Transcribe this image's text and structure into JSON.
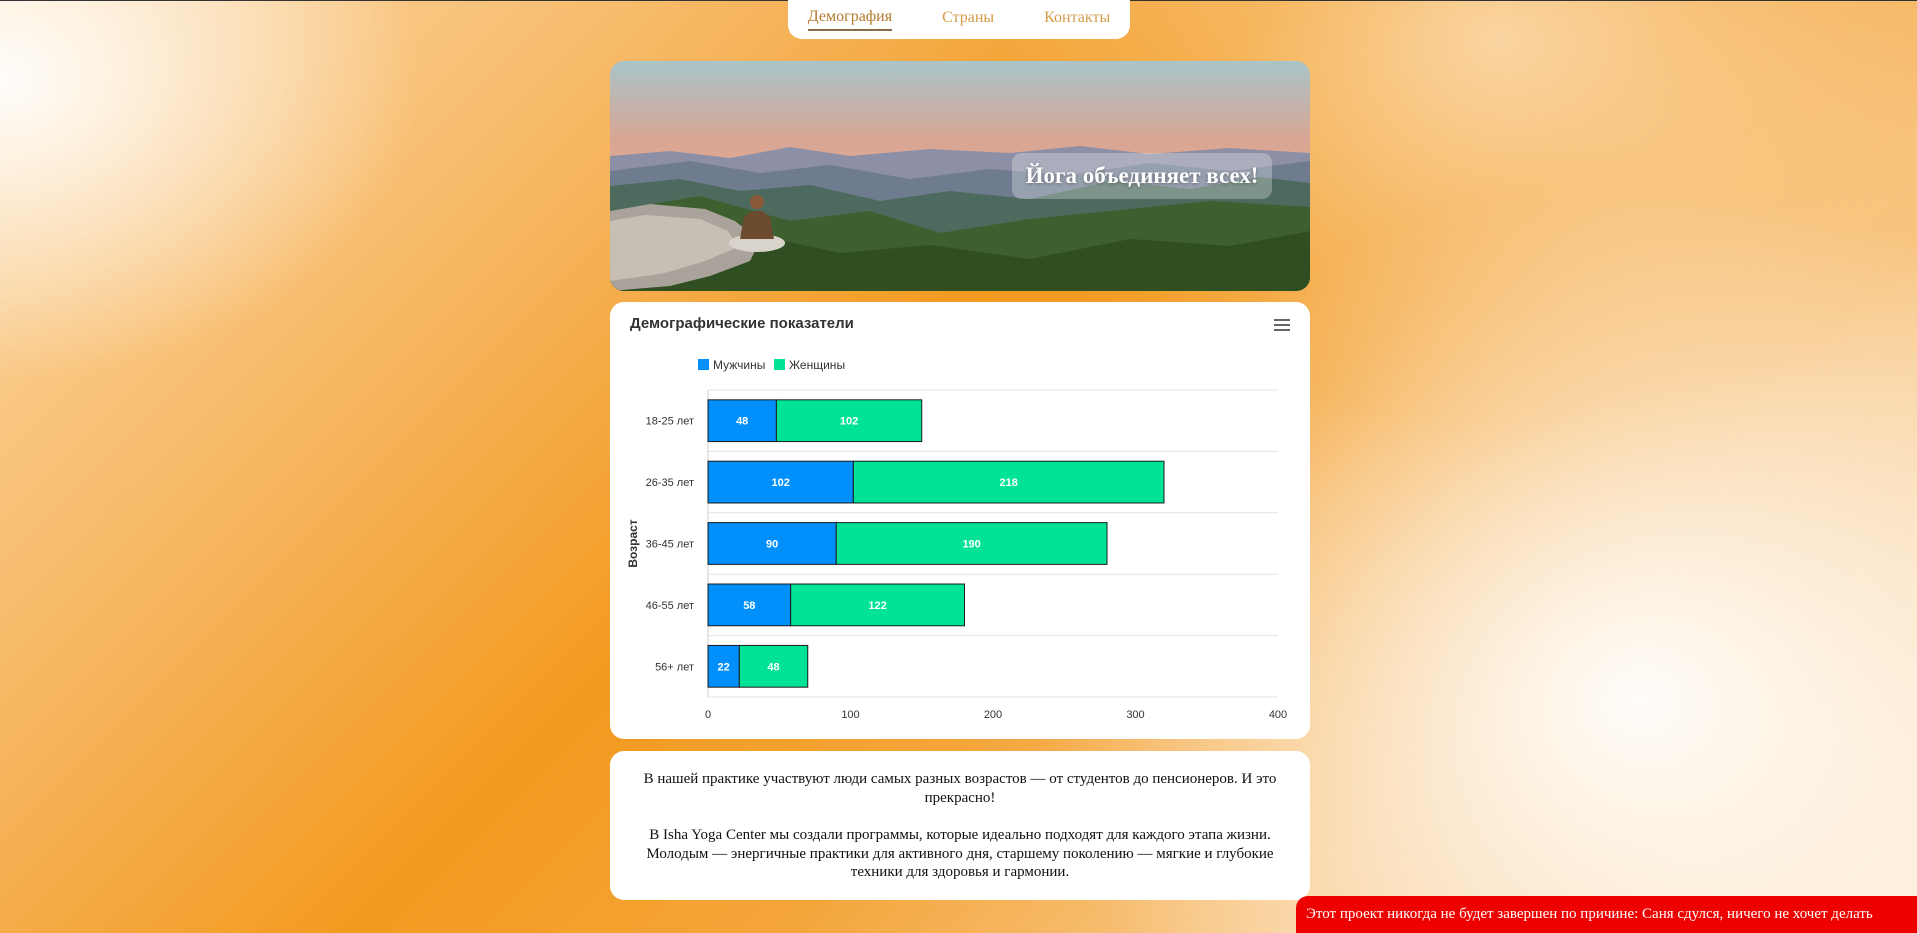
{
  "nav": {
    "items": [
      {
        "label": "Демография",
        "active": true
      },
      {
        "label": "Страны",
        "active": false
      },
      {
        "label": "Контакты",
        "active": false
      }
    ]
  },
  "hero": {
    "title": "Йога объединяет всех!"
  },
  "chart_card": {
    "menu_icon": "hamburger-menu-icon"
  },
  "chart_data": {
    "type": "bar",
    "orientation": "horizontal",
    "stacked": true,
    "title": "Демографические показатели",
    "ylabel": "Возраст",
    "xlabel": "",
    "categories": [
      "18-25 лет",
      "26-35 лет",
      "36-45 лет",
      "46-55 лет",
      "56+ лет"
    ],
    "series": [
      {
        "name": "Мужчины",
        "color": "#008ffb",
        "values": [
          48,
          102,
          90,
          58,
          22
        ]
      },
      {
        "name": "Женщины",
        "color": "#00e396",
        "values": [
          102,
          218,
          190,
          122,
          48
        ]
      }
    ],
    "xlim": [
      0,
      400
    ],
    "xticks": [
      0,
      100,
      200,
      300,
      400
    ],
    "legend": "top-left",
    "grid": true
  },
  "text": {
    "p1": "В нашей практике участвуют люди самых разных возрастов — от студентов до пенсионеров. И это прекрасно!",
    "p2": "В Isha Yoga Center мы создали программы, которые идеально подходят для каждого этапа жизни. Молодым — энергичные практики для активного дня, старшему поколению — мягкие и глубокие техники для здоровья и гармонии."
  },
  "banner": {
    "text": "Этот проект никогда не будет завершен по причине: Саня сдулся, ничего не хочет делать"
  }
}
